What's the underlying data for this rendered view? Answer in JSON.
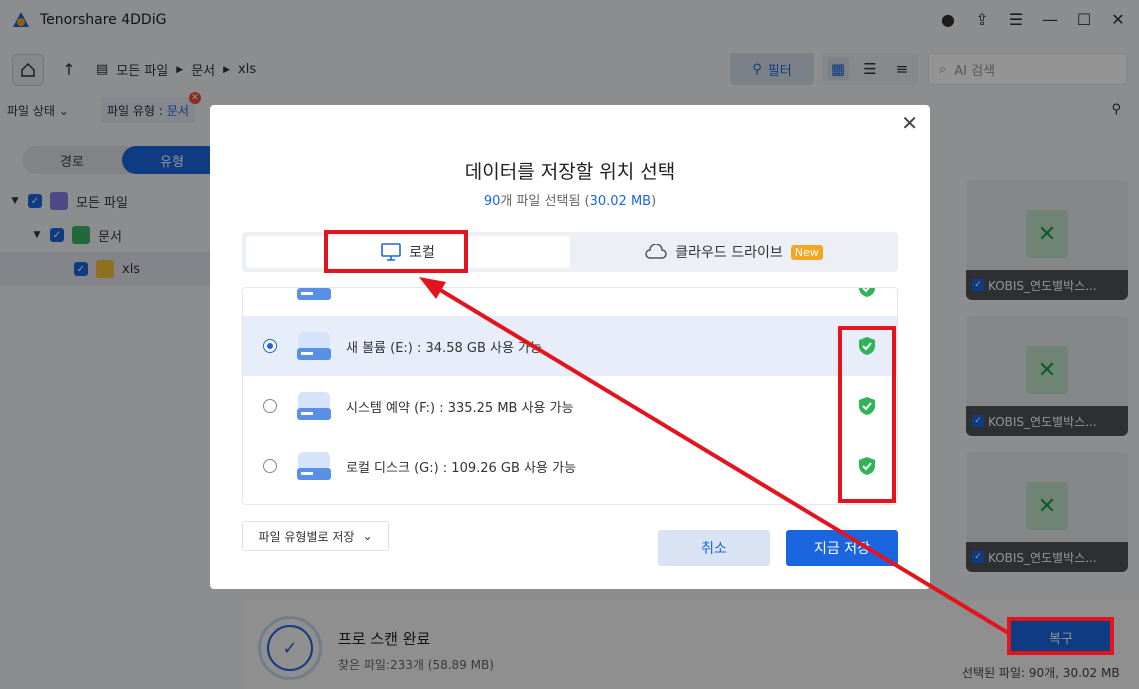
{
  "app": {
    "title": "Tenorshare 4DDiG"
  },
  "nav": {
    "breadcrumb": [
      "모든 파일",
      "문서",
      "xls"
    ],
    "filter_label": "필터",
    "search_placeholder": "AI 검색"
  },
  "filters": {
    "state_label": "파일 상태",
    "type_label": "파일 유형 :",
    "type_value": "문서"
  },
  "sidebar": {
    "toggle": [
      "경로",
      "유형"
    ],
    "tree": [
      "모든 파일",
      "문서",
      "xls"
    ]
  },
  "cards": [
    "KOBIS_연도별박스...",
    "KOBIS_연도별박스...",
    "KOBIS_연도별박스..."
  ],
  "bottom": {
    "scan_title": "프로 스캔 완료",
    "scan_sub": "찾은 파일:233개 (58.89 MB)",
    "recover": "복구",
    "selected": "선택된 파일: 90개, 30.02 MB"
  },
  "modal": {
    "title": "데이터를 저장할 위치 선택",
    "sub_count": "90",
    "sub_mid": "개 파일 선택됨 (",
    "sub_size": "30.02 MB",
    "sub_end": ")",
    "tab_local": "로컬",
    "tab_cloud": "클라우드 드라이브",
    "new_badge": "New",
    "drives": [
      "새 볼륨 (E:) : 34.58 GB 사용 가능",
      "시스템 예약 (F:) : 335.25 MB 사용 가능",
      "로컬 디스크 (G:) : 109.26 GB 사용 가능"
    ],
    "save_type": "파일 유형별로 저장",
    "cancel": "취소",
    "save_now": "지금 저장"
  },
  "colors": {
    "accent": "#1a66e0",
    "highlight": "#e3141d",
    "safe": "#2fb45a"
  }
}
